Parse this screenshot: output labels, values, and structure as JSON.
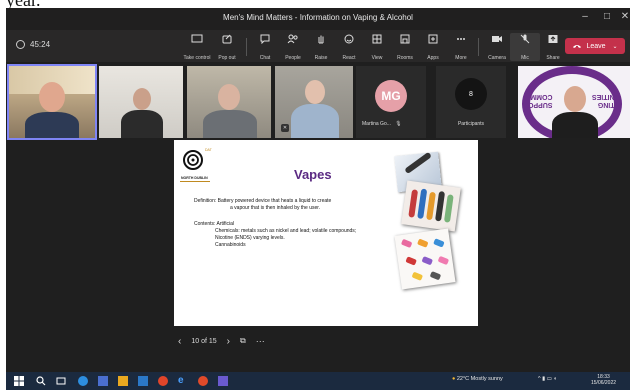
{
  "caption": {
    "text": "year."
  },
  "window": {
    "title": "Men's Mind Matters - Information on Vaping & Alcohol"
  },
  "toolbar": {
    "timer": "45:24",
    "buttons": [
      {
        "label": "Take control",
        "icon": "take-control-icon"
      },
      {
        "label": "Pop out",
        "icon": "pop-out-icon"
      },
      {
        "label": "Chat",
        "icon": "chat-icon"
      },
      {
        "label": "People",
        "icon": "people-icon"
      },
      {
        "label": "Raise",
        "icon": "raise-hand-icon"
      },
      {
        "label": "React",
        "icon": "react-icon"
      },
      {
        "label": "View",
        "icon": "view-icon"
      },
      {
        "label": "Rooms",
        "icon": "rooms-icon"
      },
      {
        "label": "Apps",
        "icon": "apps-icon"
      },
      {
        "label": "More",
        "icon": "more-icon"
      },
      {
        "label": "Camera",
        "icon": "camera-icon"
      },
      {
        "label": "Mic",
        "icon": "mic-off-icon"
      },
      {
        "label": "Share",
        "icon": "share-icon"
      }
    ],
    "leave_label": "Leave"
  },
  "participants": {
    "mg_initials": "MG",
    "mg_name": "Martina Go...",
    "count": "8",
    "count_label": "Participants",
    "logo_left_text": "SUPPO",
    "logo_left_text2": "COMM",
    "logo_right_text": "RTING",
    "logo_right_text2": "UNITIES"
  },
  "slide": {
    "org_name": "NORTH DUBLIN",
    "org_sub": "DAT",
    "title": "Vapes",
    "definition_line1": "Definition: Battery powered device that heats a liquid to create",
    "definition_line2": "a vapour that is then inhaled by the user.",
    "contents_heading": "Contents: Artificial",
    "contents_line1": "Chemicals: metals such as nickel and lead; volatile compounds;",
    "contents_line2": "Nicotine (ENDS) varying levels.",
    "contents_line3": "Cannabinoids"
  },
  "slide_nav": {
    "counter": "10 of 15"
  },
  "taskbar": {
    "weather": "22°C  Mostly sunny",
    "time": "18:33",
    "date": "15/06/2022"
  },
  "colors": {
    "accent": "#7f85f5",
    "leave": "#c4314b",
    "slide_title": "#5b2a83",
    "avatar": "#e5a0a8"
  }
}
